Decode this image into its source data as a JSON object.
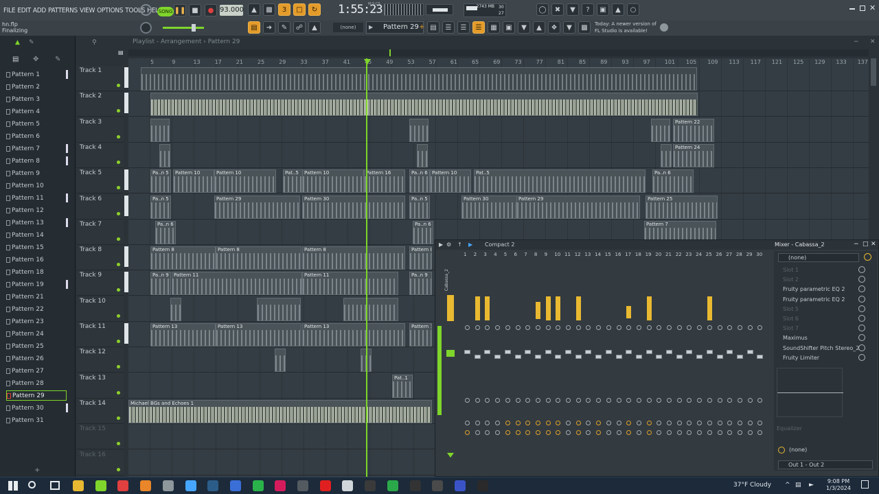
{
  "menu": {
    "items": [
      "FILE",
      "EDIT",
      "ADD",
      "PATTERNS",
      "VIEW",
      "OPTIONS",
      "TOOLS",
      "HELP"
    ]
  },
  "transport": {
    "mode": "SONG",
    "tempo": "93.000",
    "time": "1:55:23",
    "time_unit": "M:S:CS",
    "cpu": "30",
    "memory": "2743 MB",
    "polyphony": "27"
  },
  "project": {
    "file": "hn.flp",
    "status": "Finalizing"
  },
  "pattern_selector": {
    "current": "Pattern 29",
    "none_label": "(none)"
  },
  "news": {
    "text_line1": "Today: A newer version of",
    "text_line2": "FL Studio is available!"
  },
  "playlist": {
    "title": "Playlist - Arrangement",
    "pattern": "Pattern 29",
    "ruler": [
      "5",
      "9",
      "13",
      "17",
      "21",
      "25",
      "29",
      "33",
      "37",
      "41",
      "45",
      "49",
      "53",
      "57",
      "61",
      "65",
      "69",
      "73",
      "77",
      "81",
      "85",
      "89",
      "93",
      "97",
      "101",
      "105",
      "109",
      "113",
      "117",
      "121",
      "125",
      "129",
      "133",
      "137"
    ],
    "tracks": [
      "Track 1",
      "Track 2",
      "Track 3",
      "Track 4",
      "Track 5",
      "Track 6",
      "Track 7",
      "Track 8",
      "Track 9",
      "Track 10",
      "Track 11",
      "Track 12",
      "Track 13",
      "Track 14",
      "Track 15",
      "Track 16"
    ],
    "audio_clip": "Michael BGs and Echoes 1"
  },
  "clip_labels": {
    "p22": "Pattern 22",
    "p24": "Pattern 24",
    "p10": "Pattern 10",
    "p29": "Pattern 29",
    "p30": "Pattern 30",
    "p25": "Pattern 25",
    "p7": "Pattern 7",
    "p8": "Pattern 8",
    "p11": "Pattern 11",
    "p13": "Pattern 13",
    "p16": "Pattern 16",
    "pat1": "Pat..1",
    "pan6": "Pa..n 6",
    "pan9": "Pa..n 9",
    "pat5": "Pat..5",
    "pan5": "Pa..n 5"
  },
  "browser": {
    "patterns": [
      "Pattern 1",
      "Pattern 2",
      "Pattern 3",
      "Pattern 4",
      "Pattern 5",
      "Pattern 6",
      "Pattern 7",
      "Pattern 8",
      "Pattern 9",
      "Pattern 10",
      "Pattern 11",
      "Pattern 12",
      "Pattern 13",
      "Pattern 14",
      "Pattern 15",
      "Pattern 16",
      "Pattern 18",
      "Pattern 19",
      "Pattern 21",
      "Pattern 22",
      "Pattern 23",
      "Pattern 24",
      "Pattern 25",
      "Pattern 26",
      "Pattern 27",
      "Pattern 28",
      "Pattern 29",
      "Pattern 30",
      "Pattern 31"
    ],
    "selected": "Pattern 29"
  },
  "mixer": {
    "title": "Mixer - Cabassa_2",
    "view": "Compact 2",
    "current_insert": "Cabassa_2",
    "numbers": [
      "1",
      "2",
      "3",
      "4",
      "5",
      "6",
      "7",
      "8",
      "9",
      "10",
      "11",
      "12",
      "13",
      "14",
      "15",
      "16",
      "17",
      "18",
      "19",
      "20",
      "21",
      "22",
      "23",
      "24",
      "25",
      "26",
      "27",
      "28",
      "29",
      "30"
    ],
    "fx_slots": [
      {
        "name": "Slot 1",
        "active": false
      },
      {
        "name": "Slot 2",
        "active": false
      },
      {
        "name": "Fruity parametric EQ 2",
        "active": true
      },
      {
        "name": "Fruity parametric EQ 2",
        "active": true
      },
      {
        "name": "Slot 5",
        "active": false
      },
      {
        "name": "Slot 6",
        "active": false
      },
      {
        "name": "Slot 7",
        "active": false
      },
      {
        "name": "Maximus",
        "active": true
      },
      {
        "name": "SoundShifter Pitch Stereo_2",
        "active": true
      },
      {
        "name": "Fruity Limiter",
        "active": true
      }
    ],
    "input": "(none)",
    "output": "(none)",
    "routing": "Out 1 - Out 2",
    "eq_label": "Equalizer"
  },
  "taskbar": {
    "weather": "37°F  Cloudy",
    "time": "9:08 PM",
    "date": "1/3/2024"
  },
  "colors": {
    "accent": "#e39b2a",
    "playhead": "#7fd52b",
    "meter": "#e9b931"
  }
}
